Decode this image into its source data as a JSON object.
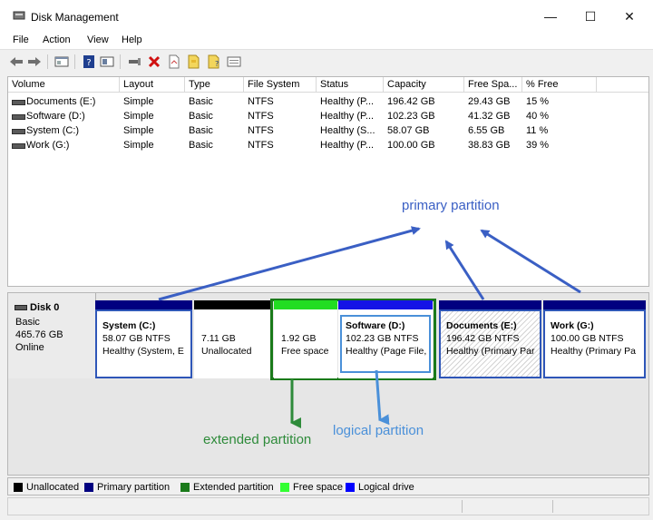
{
  "window": {
    "title": "Disk Management",
    "minimize": "—",
    "maximize": "☐",
    "close": "✕"
  },
  "menu": [
    "File",
    "Action",
    "View",
    "Help"
  ],
  "toolbar_icons": [
    "back-arrow-icon",
    "forward-arrow-icon",
    "console-tree-icon",
    "help-icon",
    "properties-icon",
    "connect-icon",
    "delete-icon",
    "new-icon",
    "folder-icon",
    "folder-help-icon",
    "view-icon"
  ],
  "volumes": {
    "columns": [
      "Volume",
      "Layout",
      "Type",
      "File System",
      "Status",
      "Capacity",
      "Free Spa...",
      "% Free"
    ],
    "rows": [
      [
        "Documents (E:)",
        "Simple",
        "Basic",
        "NTFS",
        "Healthy (P...",
        "196.42 GB",
        "29.43 GB",
        "15 %"
      ],
      [
        "Software (D:)",
        "Simple",
        "Basic",
        "NTFS",
        "Healthy (P...",
        "102.23 GB",
        "41.32 GB",
        "40 %"
      ],
      [
        "System (C:)",
        "Simple",
        "Basic",
        "NTFS",
        "Healthy (S...",
        "58.07 GB",
        "6.55 GB",
        "11 %"
      ],
      [
        "Work (G:)",
        "Simple",
        "Basic",
        "NTFS",
        "Healthy (P...",
        "100.00 GB",
        "38.83 GB",
        "39 %"
      ]
    ]
  },
  "disk": {
    "name": "Disk 0",
    "type": "Basic",
    "size": "465.76 GB",
    "state": "Online"
  },
  "partitions": [
    {
      "name": "System  (C:)",
      "size": "58.07 GB NTFS",
      "status": "Healthy (System, E"
    },
    {
      "name": "",
      "size": "7.11 GB",
      "status": "Unallocated"
    },
    {
      "name": "",
      "size": "1.92 GB",
      "status": "Free space"
    },
    {
      "name": "Software  (D:)",
      "size": "102.23 GB NTFS",
      "status": "Healthy (Page File,"
    },
    {
      "name": "Documents  (E:)",
      "size": "196.42 GB NTFS",
      "status": "Healthy (Primary Par"
    },
    {
      "name": "Work  (G:)",
      "size": "100.00 GB NTFS",
      "status": "Healthy (Primary Pa"
    }
  ],
  "annotations": {
    "primary": "primary partition",
    "extended": "extended partition",
    "logical": "logical partition"
  },
  "legend": [
    {
      "label": "Unallocated",
      "color": "#000000"
    },
    {
      "label": "Primary partition",
      "color": "#000080"
    },
    {
      "label": "Extended partition",
      "color": "#1a7a1a"
    },
    {
      "label": "Free space",
      "color": "#33ff33"
    },
    {
      "label": "Logical drive",
      "color": "#0000ff"
    }
  ],
  "colors": {
    "primary": "#000080",
    "unallocated": "#000000",
    "free": "#22dd22",
    "logical": "#1414e6",
    "extended_box": "#1a7a1a",
    "highlight_box": "#2e56b8",
    "annotation_blue": "#3a5fc4",
    "annotation_green": "#2e8b3a",
    "annotation_logical": "#4a90d9"
  }
}
